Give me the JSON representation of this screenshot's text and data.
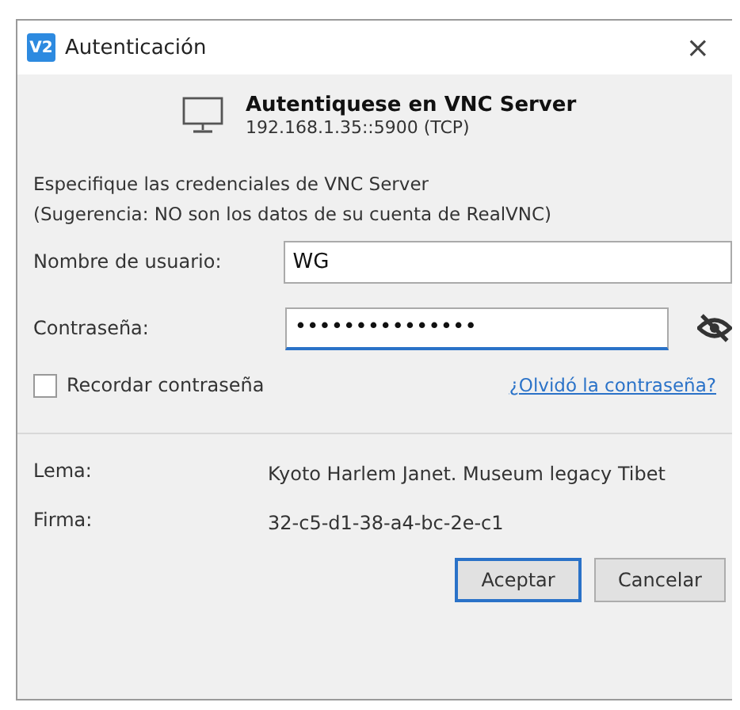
{
  "window": {
    "logo": "V2",
    "title": "Autenticación",
    "close": "×"
  },
  "header": {
    "title": "Autentiquese en VNC Server",
    "address": "192.168.1.35::5900 (TCP)"
  },
  "instructions": [
    "Especifique las credenciales de VNC Server",
    "(Sugerencia: NO son los datos de su cuenta de RealVNC)"
  ],
  "username": {
    "label": "Nombre de usuario:",
    "value": "WG"
  },
  "password": {
    "label": "Contraseña:",
    "value": "•••••••••••••••",
    "focused": true
  },
  "remember": {
    "label": "Recordar contraseña",
    "checked": false
  },
  "forgot_link": "¿Olvidó la contraseña?",
  "details": [
    {
      "label": "Lema:",
      "value": "Kyoto Harlem Janet. Museum legacy Tibet"
    },
    {
      "label": "Firma:",
      "value": "32-c5-d1-38-a4-bc-2e-c1"
    }
  ],
  "buttons": [
    {
      "label": "Aceptar",
      "default": true
    },
    {
      "label": "Cancelar",
      "default": false
    }
  ]
}
